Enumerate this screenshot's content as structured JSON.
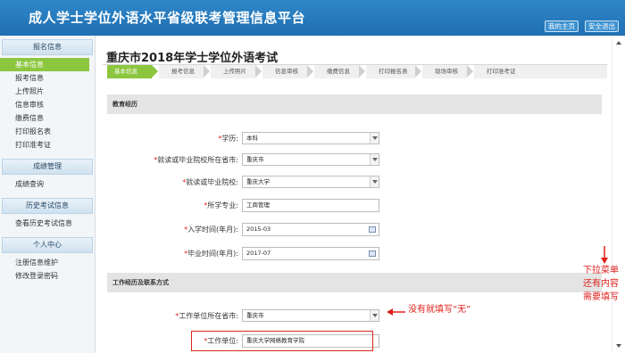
{
  "header": {
    "title": "成人学士学位外语水平省级联考管理信息平台",
    "home_label": "我的主页",
    "logout_label": "安全退出"
  },
  "sidebar": {
    "groups": [
      {
        "title": "报名信息",
        "items": [
          "基本信息",
          "报考信息",
          "上传照片",
          "信息审核",
          "缴费信息",
          "打印报名表",
          "打印准考证"
        ]
      },
      {
        "title": "成绩管理",
        "items": [
          "成绩查询"
        ]
      },
      {
        "title": "历史考试信息",
        "items": [
          "查看历史考试信息"
        ]
      },
      {
        "title": "个人中心",
        "items": [
          "注册信息维护",
          "修改登录密码"
        ]
      }
    ],
    "active_item": "基本信息"
  },
  "main": {
    "page_title": "重庆市2018年学士学位外语考试",
    "steps": [
      "基本信息",
      "报考信息",
      "上传照片",
      "信息审核",
      "缴费信息",
      "打印报名表",
      "现场审核",
      "打印准考证"
    ],
    "section1": "教育经历",
    "section2": "工作经历及联系方式",
    "fields": {
      "education": {
        "label": "学历:",
        "value": "本科"
      },
      "school_province": {
        "label": "就读或毕业院校所在省市:",
        "value": "重庆市"
      },
      "school": {
        "label": "就读或毕业院校:",
        "value": "重庆大学"
      },
      "major": {
        "label": "所学专业:",
        "value": "工商管理"
      },
      "enroll_time": {
        "label": "入学时间(年月):",
        "value": "2015-03"
      },
      "grad_time": {
        "label": "毕业时间(年月):",
        "value": "2017-07"
      },
      "work_province": {
        "label": "工作单位所在省市:",
        "value": "重庆市"
      },
      "work_unit": {
        "label": "工作单位:",
        "value": "重庆大学网络教育学院"
      }
    },
    "required_mark": "*"
  },
  "annotations": {
    "fill_none": "没有就填写“无”",
    "dropdown_more": [
      "下拉菜单",
      "还有内容",
      "需要填写"
    ],
    "color": "#e0201c"
  },
  "colors": {
    "header_blue": "#1f6fb3",
    "active_green": "#8cc63f",
    "required_red": "#e0201c"
  }
}
